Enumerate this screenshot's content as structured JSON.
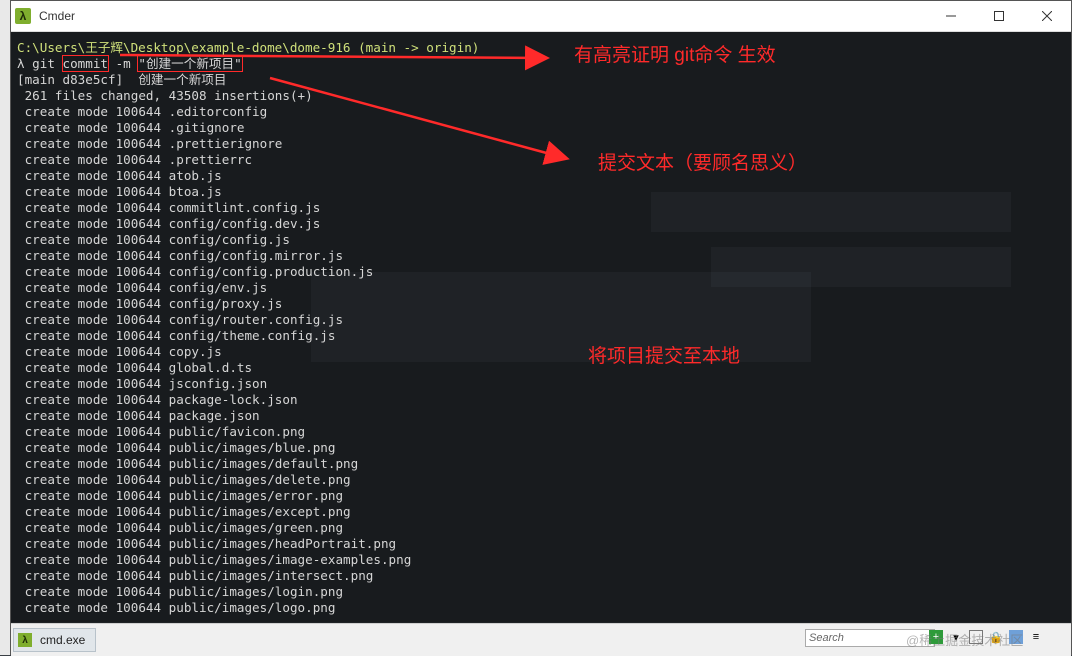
{
  "window": {
    "title": "Cmder",
    "min_icon": "minimize-icon",
    "max_icon": "maximize-icon",
    "close_icon": "close-icon"
  },
  "terminal": {
    "prompt_path": "C:\\Users\\王子辉\\Desktop\\example-dome\\dome-916",
    "prompt_branch": " (main -> origin)",
    "cmd_lambda": "λ",
    "cmd_git": " git ",
    "cmd_commit": "commit",
    "cmd_flag": " -m ",
    "cmd_message": "\"创建一个新项目\"",
    "result_header": "[main d83e5cf]  创建一个新项目",
    "summary": " 261 files changed, 43508 insertions(+)",
    "create_prefix": " create mode 100644 ",
    "files": [
      ".editorconfig",
      ".gitignore",
      ".prettierignore",
      ".prettierrc",
      "atob.js",
      "btoa.js",
      "commitlint.config.js",
      "config/config.dev.js",
      "config/config.js",
      "config/config.mirror.js",
      "config/config.production.js",
      "config/env.js",
      "config/proxy.js",
      "config/router.config.js",
      "config/theme.config.js",
      "copy.js",
      "global.d.ts",
      "jsconfig.json",
      "package-lock.json",
      "package.json",
      "public/favicon.png",
      "public/images/blue.png",
      "public/images/default.png",
      "public/images/delete.png",
      "public/images/error.png",
      "public/images/except.png",
      "public/images/green.png",
      "public/images/headPortrait.png",
      "public/images/image-examples.png",
      "public/images/intersect.png",
      "public/images/login.png",
      "public/images/logo.png"
    ]
  },
  "annotations": {
    "highlight_note": "有高亮证明 git命令 生效",
    "commit_text_note": "提交文本（要顾名思义）",
    "commit_local_note": "将项目提交至本地"
  },
  "statusbar": {
    "tab_icon": "λ",
    "tab_label": "cmd.exe",
    "search_placeholder": "Search"
  },
  "watermark": "@稀土掘金技术社区",
  "colors": {
    "annotation": "#ff2a2a",
    "path": "#cfe07a",
    "terminal_bg": "#181b1e"
  }
}
